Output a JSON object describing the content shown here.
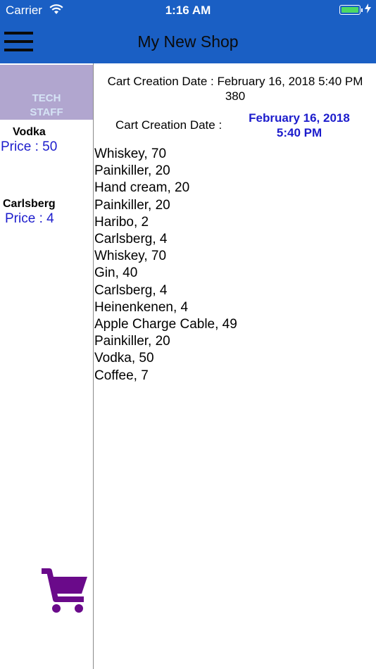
{
  "status_bar": {
    "carrier": "Carrier",
    "time": "1:16 AM",
    "battery_level": 1.0
  },
  "nav": {
    "title": "My New Shop",
    "menu_icon": "hamburger-menu-icon"
  },
  "sidebar": {
    "staff_label_1": "TECH",
    "staff_label_2": "STAFF",
    "products": [
      {
        "name": "Vodka",
        "price": "Price : 50"
      },
      {
        "name": "Carlsberg",
        "price": "Price : 4"
      }
    ],
    "cart_icon": "shopping-cart-icon"
  },
  "cart": {
    "header_line": "Cart Creation Date : February 16, 2018 5:40 PM",
    "header_total": "380",
    "date_label": "Cart Creation Date :",
    "date_value_line1": "February 16, 2018",
    "date_value_line2": "5:40 PM",
    "items": [
      "Whiskey, 70",
      "Painkiller, 20",
      "Hand cream, 20",
      "Painkiller, 20",
      "Haribo, 2",
      "Carlsberg, 4",
      "Whiskey, 70",
      "Gin, 40",
      "Carlsberg, 4",
      "Heinenkenen, 4",
      "Apple Charge Cable, 49",
      "Painkiller, 20",
      "Vodka, 50",
      "Coffee, 7"
    ]
  },
  "colors": {
    "nav_bar": "#1a5fc4",
    "staff_block": "#b1a6cf",
    "price_text": "#1c1ccc",
    "cart_icon": "#6a0a8a"
  }
}
